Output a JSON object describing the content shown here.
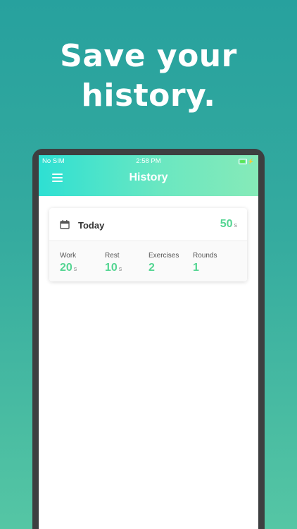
{
  "headline": {
    "line1": "Save your",
    "line2": "history."
  },
  "status_bar": {
    "carrier": "No SIM",
    "time": "2:58 PM",
    "battery_level": 0.9,
    "battery_color": "#5ce55a"
  },
  "nav": {
    "title": "History",
    "menu_icon": "hamburger-menu-icon"
  },
  "card": {
    "icon": "calendar-icon",
    "title": "Today",
    "total_value": "50",
    "total_unit": "s",
    "stats": [
      {
        "label": "Work",
        "value": "20",
        "unit": "s"
      },
      {
        "label": "Rest",
        "value": "10",
        "unit": "s"
      },
      {
        "label": "Exercises",
        "value": "2",
        "unit": ""
      },
      {
        "label": "Rounds",
        "value": "1",
        "unit": ""
      }
    ]
  },
  "colors": {
    "accent_green": "#54d592",
    "header_gradient_start": "#2ee0d3",
    "header_gradient_end": "#86eab8",
    "background_top": "#27a19e",
    "background_bottom": "#55c6a4"
  }
}
